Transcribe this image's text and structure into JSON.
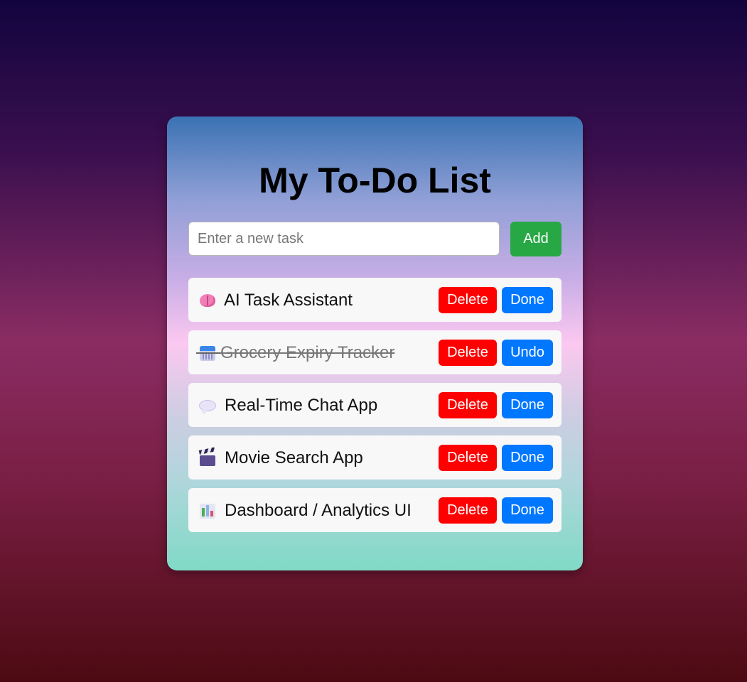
{
  "app": {
    "title": "My To-Do List"
  },
  "input": {
    "placeholder": "Enter a new task",
    "value": ""
  },
  "add_button": {
    "label": "Add"
  },
  "tasks": [
    {
      "icon": "brain-icon",
      "label": "AI Task Assistant",
      "completed": false,
      "delete_label": "Delete",
      "toggle_label": "Done"
    },
    {
      "icon": "calendar-icon",
      "label": "Grocery Expiry Tracker",
      "completed": true,
      "delete_label": "Delete",
      "toggle_label": "Undo"
    },
    {
      "icon": "speech-bubble-icon",
      "label": "Real-Time Chat App",
      "completed": false,
      "delete_label": "Delete",
      "toggle_label": "Done"
    },
    {
      "icon": "clapper-board-icon",
      "label": "Movie Search App",
      "completed": false,
      "delete_label": "Delete",
      "toggle_label": "Done"
    },
    {
      "icon": "bar-chart-icon",
      "label": "Dashboard / Analytics UI",
      "completed": false,
      "delete_label": "Delete",
      "toggle_label": "Done"
    }
  ],
  "colors": {
    "add": "#28a745",
    "delete": "#ff0000",
    "done": "#0077ff"
  }
}
